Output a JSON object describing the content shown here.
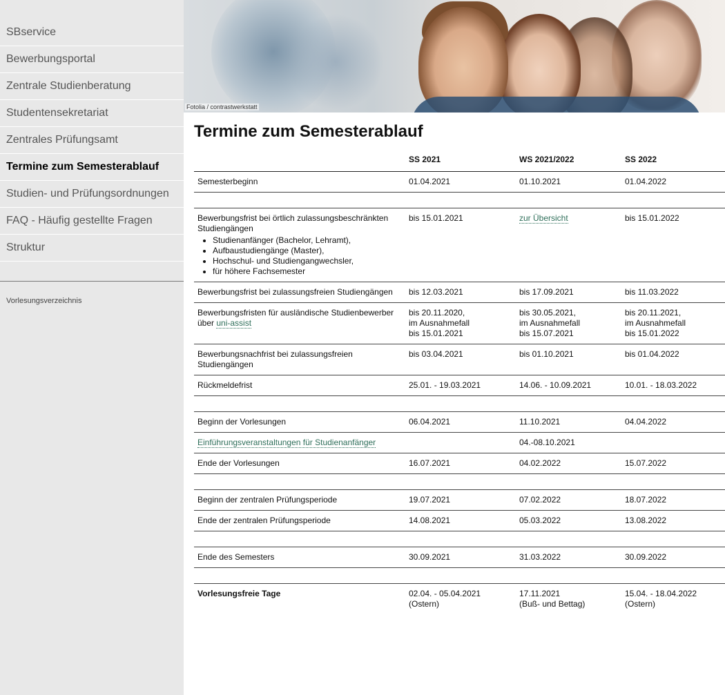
{
  "sidebar": {
    "items": [
      {
        "label": "SBservice"
      },
      {
        "label": "Bewerbungsportal"
      },
      {
        "label": "Zentrale Studienberatung"
      },
      {
        "label": "Studentensekretariat"
      },
      {
        "label": "Zentrales Prüfungsamt"
      },
      {
        "label": "Termine zum Semesterablauf",
        "active": true
      },
      {
        "label": "Studien- und Prüfungsordnungen"
      },
      {
        "label": "FAQ - Häufig gestellte Fragen"
      },
      {
        "label": "Struktur"
      }
    ],
    "secondary": "Vorlesungsverzeichnis"
  },
  "hero": {
    "credit": "Fotolia / contrastwerkstatt"
  },
  "main": {
    "title": "Termine zum Semesterablauf",
    "columns": [
      "",
      "SS 2021",
      "WS 2021/2022",
      "SS 2022"
    ],
    "rows": {
      "semesterbeginn": {
        "label": "Semesterbeginn",
        "c1": "01.04.2021",
        "c2": "01.10.2021",
        "c3": "01.04.2022"
      },
      "bewerbungsfrist_oertlich": {
        "label": "Bewerbungsfrist bei örtlich zulassungsbeschränkten Studiengängen",
        "bullets": [
          "Studienanfänger (Bachelor, Lehramt),",
          "Aufbaustudiengänge (Master),",
          "Hochschul- und Studiengangwechsler,",
          "für höhere Fachsemester"
        ],
        "c1": "bis 15.01.2021",
        "c2": "zur Übersicht",
        "c3": "bis 15.01.2022"
      },
      "bewerbungsfrist_frei": {
        "label": "Bewerbungsfrist bei zulassungsfreien Studiengängen",
        "c1": "bis 12.03.2021",
        "c2": "bis 17.09.2021",
        "c3": "bis 11.03.2022"
      },
      "auslaendisch": {
        "label_pre": "Bewerbungsfristen für ausländische Studienbewerber über ",
        "label_link": "uni-assist",
        "c1": [
          "bis 20.11.2020,",
          "im Ausnahmefall",
          "bis 15.01.2021"
        ],
        "c2": [
          "bis 30.05.2021,",
          "im Ausnahmefall",
          "bis 15.07.2021"
        ],
        "c3": [
          "bis 20.11.2021,",
          "im Ausnahmefall",
          "bis 15.01.2022"
        ]
      },
      "nachfrist": {
        "label": "Bewerbungsnachfrist bei zulassungsfreien Studiengängen",
        "c1": "bis 03.04.2021",
        "c2": "bis 01.10.2021",
        "c3": "bis 01.04.2022"
      },
      "rueckmeldefrist": {
        "label": "Rückmeldefrist",
        "c1": "25.01. - 19.03.2021",
        "c2": "14.06. - 10.09.2021",
        "c3": "10.01. - 18.03.2022"
      },
      "beginn_vorlesungen": {
        "label": "Beginn der Vorlesungen",
        "c1": "06.04.2021",
        "c2": "11.10.2021",
        "c3": "04.04.2022"
      },
      "einfuehrung": {
        "label": "Einführungsveranstaltungen für Studienanfänger",
        "c1": "",
        "c2": "04.-08.10.2021",
        "c3": ""
      },
      "ende_vorlesungen": {
        "label": "Ende der Vorlesungen",
        "c1": "16.07.2021",
        "c2": "04.02.2022",
        "c3": "15.07.2022"
      },
      "beginn_pruefung": {
        "label": "Beginn der zentralen Prüfungsperiode",
        "c1": "19.07.2021",
        "c2": "07.02.2022",
        "c3": "18.07.2022"
      },
      "ende_pruefung": {
        "label": "Ende der zentralen Prüfungsperiode",
        "c1": "14.08.2021",
        "c2": "05.03.2022",
        "c3": "13.08.2022"
      },
      "ende_semester": {
        "label": "Ende des Semesters",
        "c1": "30.09.2021",
        "c2": "31.03.2022",
        "c3": "30.09.2022"
      },
      "vorlesungsfrei": {
        "label": "Vorlesungsfreie Tage",
        "c1": [
          "02.04. - 05.04.2021",
          "(Ostern)"
        ],
        "c2": [
          "17.11.2021",
          "(Buß- und Bettag)"
        ],
        "c3": [
          "15.04. - 18.04.2022",
          "(Ostern)"
        ]
      }
    }
  }
}
